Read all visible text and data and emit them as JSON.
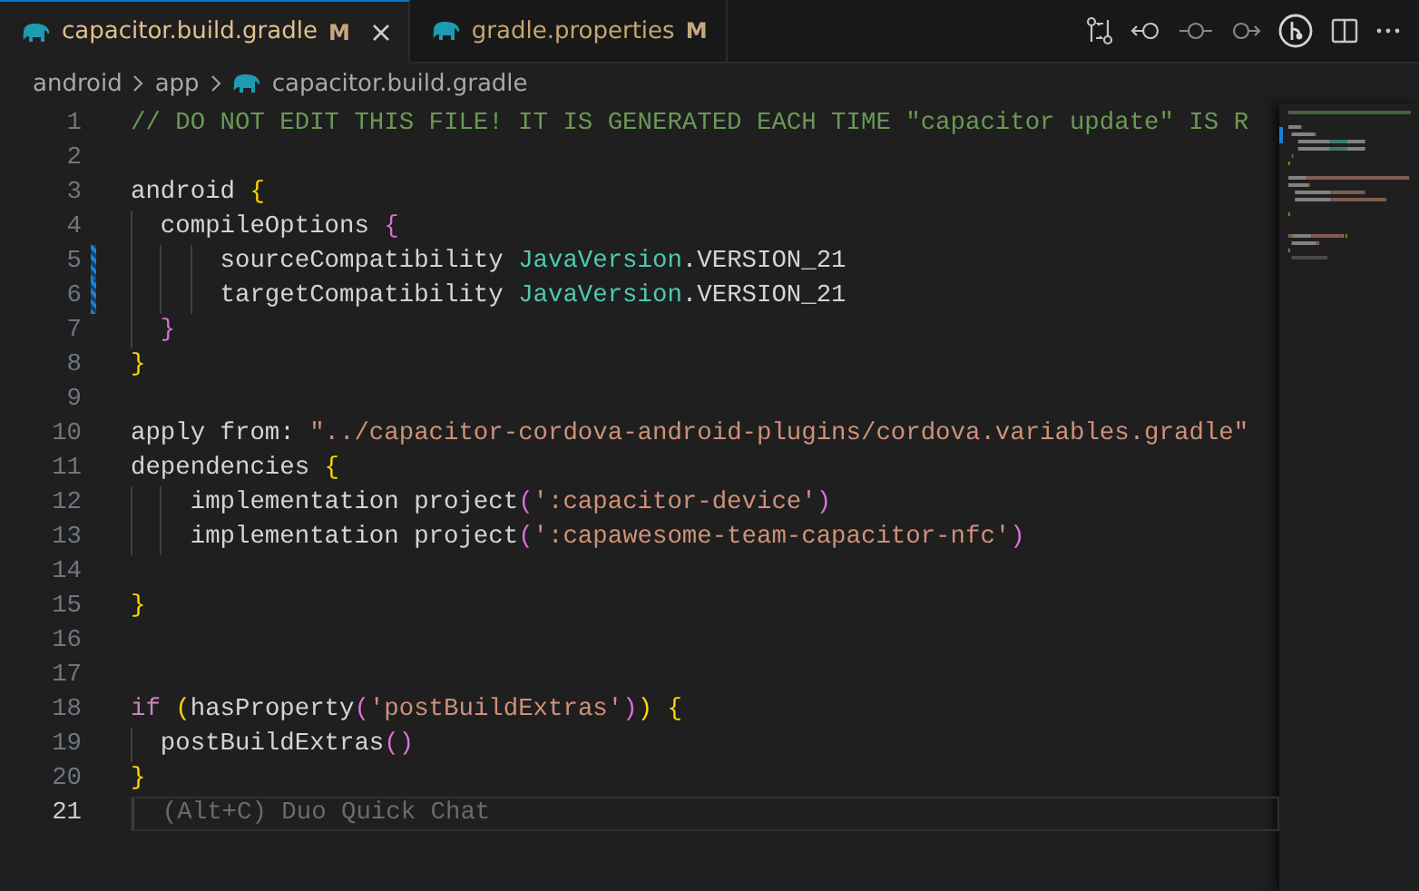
{
  "tabs": [
    {
      "label": "capacitor.build.gradle",
      "status": "M",
      "selected": true
    },
    {
      "label": "gradle.properties",
      "status": "M",
      "selected": false
    }
  ],
  "breadcrumbs": [
    "android",
    "app",
    "capacitor.build.gradle"
  ],
  "lines": [
    {
      "number": "1",
      "modified": false,
      "selected": false,
      "tokens": [
        {
          "kind": "comment",
          "text": "// DO NOT EDIT THIS FILE! IT IS GENERATED EACH TIME \"capacitor update\" IS R"
        }
      ]
    },
    {
      "number": "2",
      "modified": false,
      "selected": false
    },
    {
      "number": "3",
      "modified": false,
      "selected": false,
      "tokens": [
        {
          "kind": "plain",
          "text": "android "
        },
        {
          "kind": "bracket1",
          "text": "{"
        }
      ]
    },
    {
      "number": "4",
      "modified": false,
      "selected": false,
      "tokens": [
        {
          "kind": "plain",
          "text": "  compileOptions "
        },
        {
          "kind": "bracket2",
          "text": "{"
        }
      ]
    },
    {
      "number": "5",
      "modified": true,
      "selected": false,
      "tokens": [
        {
          "kind": "plain",
          "text": "      sourceCompatibility "
        },
        {
          "kind": "type",
          "text": "JavaVersion"
        },
        {
          "kind": "plain",
          "text": ".VERSION_21"
        }
      ]
    },
    {
      "number": "6",
      "modified": true,
      "selected": false,
      "tokens": [
        {
          "kind": "plain",
          "text": "      targetCompatibility "
        },
        {
          "kind": "type",
          "text": "JavaVersion"
        },
        {
          "kind": "plain",
          "text": ".VERSION_21"
        }
      ]
    },
    {
      "number": "7",
      "modified": false,
      "selected": false,
      "tokens": [
        {
          "kind": "bracket2",
          "text": "  }"
        }
      ]
    },
    {
      "number": "8",
      "modified": false,
      "selected": false,
      "tokens": [
        {
          "kind": "bracket1",
          "text": "}"
        }
      ]
    },
    {
      "number": "9",
      "modified": false,
      "selected": false
    },
    {
      "number": "10",
      "modified": false,
      "selected": false,
      "tokens": [
        {
          "kind": "plain",
          "text": "apply from: "
        },
        {
          "kind": "string",
          "text": "\"../capacitor-cordova-android-plugins/cordova.variables.gradle\""
        }
      ]
    },
    {
      "number": "11",
      "modified": false,
      "selected": false,
      "tokens": [
        {
          "kind": "plain",
          "text": "dependencies "
        },
        {
          "kind": "bracket1",
          "text": "{"
        }
      ]
    },
    {
      "number": "12",
      "modified": false,
      "selected": false,
      "tokens": [
        {
          "kind": "plain",
          "text": "    implementation project"
        },
        {
          "kind": "bracket2",
          "text": "("
        },
        {
          "kind": "string",
          "text": "':capacitor-device'"
        },
        {
          "kind": "bracket2",
          "text": ")"
        }
      ]
    },
    {
      "number": "13",
      "modified": false,
      "selected": false,
      "tokens": [
        {
          "kind": "plain",
          "text": "    implementation project"
        },
        {
          "kind": "bracket2",
          "text": "("
        },
        {
          "kind": "string",
          "text": "':capawesome-team-capacitor-nfc'"
        },
        {
          "kind": "bracket2",
          "text": ")"
        }
      ]
    },
    {
      "number": "14",
      "modified": false,
      "selected": false
    },
    {
      "number": "15",
      "modified": false,
      "selected": false,
      "tokens": [
        {
          "kind": "bracket1",
          "text": "}"
        }
      ]
    },
    {
      "number": "16",
      "modified": false,
      "selected": false
    },
    {
      "number": "17",
      "modified": false,
      "selected": false
    },
    {
      "number": "18",
      "modified": false,
      "selected": false,
      "tokens": [
        {
          "kind": "keyword",
          "text": "if "
        },
        {
          "kind": "bracket1",
          "text": "("
        },
        {
          "kind": "plain",
          "text": "hasProperty"
        },
        {
          "kind": "bracket2",
          "text": "("
        },
        {
          "kind": "string",
          "text": "'postBuildExtras'"
        },
        {
          "kind": "bracket2",
          "text": ")"
        },
        {
          "kind": "bracket1",
          "text": ")"
        },
        {
          "kind": "bracket1",
          "text": " {"
        }
      ]
    },
    {
      "number": "19",
      "modified": false,
      "selected": false,
      "tokens": [
        {
          "kind": "plain",
          "text": "  postBuildExtras"
        },
        {
          "kind": "bracket2",
          "text": "()"
        }
      ]
    },
    {
      "number": "20",
      "modified": false,
      "selected": false,
      "tokens": [
        {
          "kind": "bracket1",
          "text": "}"
        }
      ]
    },
    {
      "number": "21",
      "modified": false,
      "selected": true,
      "tokens": [
        {
          "kind": "ghost",
          "text": "  (Alt+C) Duo Quick Chat"
        }
      ]
    }
  ]
}
